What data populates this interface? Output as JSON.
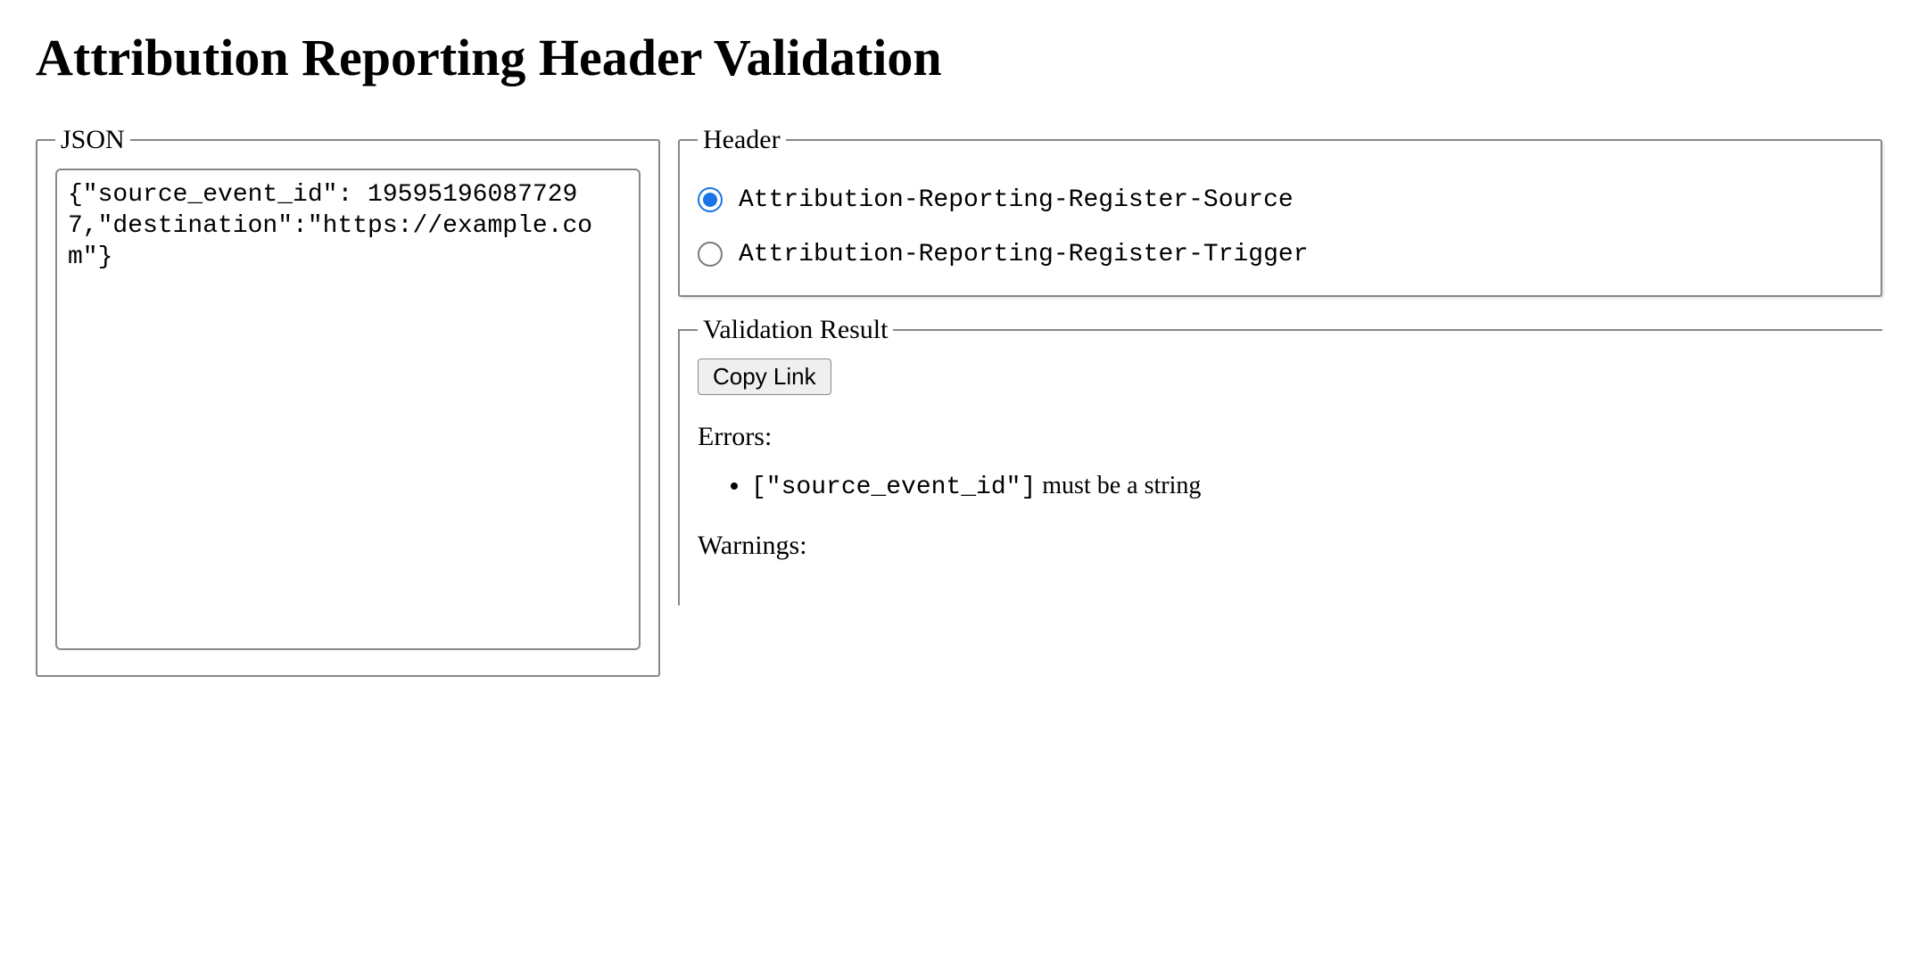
{
  "title": "Attribution Reporting Header Validation",
  "json_panel": {
    "legend": "JSON",
    "value": "{\"source_event_id\": 195951960877297,\"destination\":\"https://example.com\"}"
  },
  "header_panel": {
    "legend": "Header",
    "options": [
      {
        "label": "Attribution-Reporting-Register-Source",
        "checked": true
      },
      {
        "label": "Attribution-Reporting-Register-Trigger",
        "checked": false
      }
    ]
  },
  "result_panel": {
    "legend": "Validation Result",
    "copy_button": "Copy Link",
    "errors_label": "Errors:",
    "warnings_label": "Warnings:",
    "errors": [
      {
        "path": "[\"source_event_id\"]",
        "message": "must be a string"
      }
    ],
    "warnings": []
  }
}
